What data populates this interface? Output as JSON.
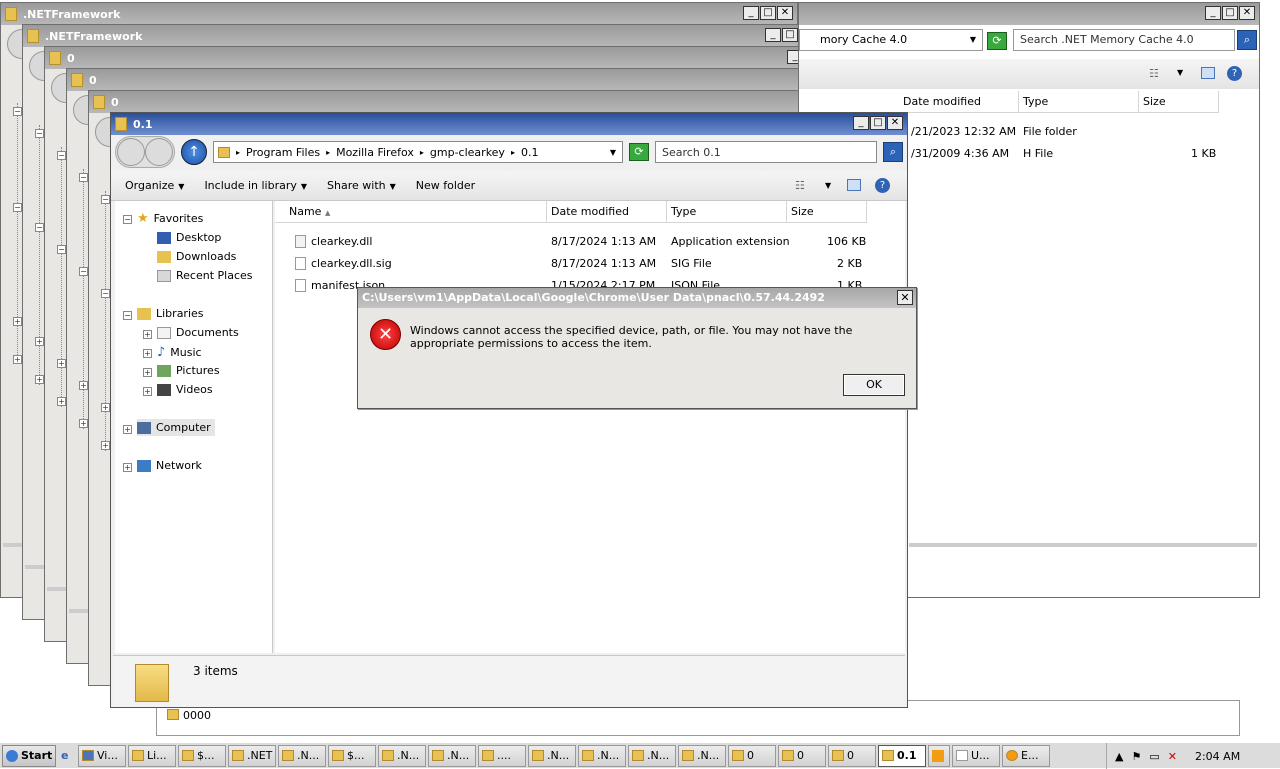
{
  "bg_windows": [
    {
      "title": ".NETFramework"
    },
    {
      "title": ".NETFramework"
    },
    {
      "title": "0"
    },
    {
      "title": "0"
    },
    {
      "title": "0"
    }
  ],
  "right_window": {
    "addr_tail": "mory Cache 4.0",
    "search_placeholder": "Search .NET Memory Cache 4.0",
    "columns": [
      "Date modified",
      "Type",
      "Size"
    ],
    "rows": [
      {
        "date": "/21/2023 12:32 AM",
        "type": "File folder",
        "size": ""
      },
      {
        "date": "/31/2009 4:36 AM",
        "type": "H File",
        "size": "1 KB"
      }
    ]
  },
  "behind_label": "0000",
  "main": {
    "title": "0.1",
    "breadcrumb": [
      "Program Files",
      "Mozilla Firefox",
      "gmp-clearkey",
      "0.1"
    ],
    "search_placeholder": "Search 0.1",
    "toolbar": {
      "organize": "Organize",
      "include": "Include in library",
      "share": "Share with",
      "newfolder": "New folder"
    },
    "nav": {
      "favorites": "Favorites",
      "desktop": "Desktop",
      "downloads": "Downloads",
      "recent": "Recent Places",
      "libraries": "Libraries",
      "documents": "Documents",
      "music": "Music",
      "pictures": "Pictures",
      "videos": "Videos",
      "computer": "Computer",
      "network": "Network"
    },
    "columns": {
      "name": "Name",
      "date": "Date modified",
      "type": "Type",
      "size": "Size"
    },
    "files": [
      {
        "name": "clearkey.dll",
        "date": "8/17/2024 1:13 AM",
        "type": "Application extension",
        "size": "106 KB"
      },
      {
        "name": "clearkey.dll.sig",
        "date": "8/17/2024 1:13 AM",
        "type": "SIG File",
        "size": "2 KB"
      },
      {
        "name": "manifest.json",
        "date": "1/15/2024 2:17 PM",
        "type": "JSON File",
        "size": "1 KB"
      }
    ],
    "status": "3 items"
  },
  "dialog": {
    "title": "C:\\Users\\vm1\\AppData\\Local\\Google\\Chrome\\User Data\\pnacl\\0.57.44.2492",
    "message": "Windows cannot access the specified device, path, or file.  You may not have the appropriate permissions to access the item.",
    "ok": "OK"
  },
  "taskbar": {
    "start": "Start",
    "buttons": [
      "Vi...",
      "Li...",
      "$...",
      ".NET",
      ".N...",
      "$...",
      ".N...",
      ".N...",
      "....",
      ".N...",
      ".N...",
      ".N...",
      ".N...",
      "0",
      "0",
      "0",
      "0.1",
      "",
      "U...",
      "E..."
    ],
    "time": "2:04 AM"
  }
}
